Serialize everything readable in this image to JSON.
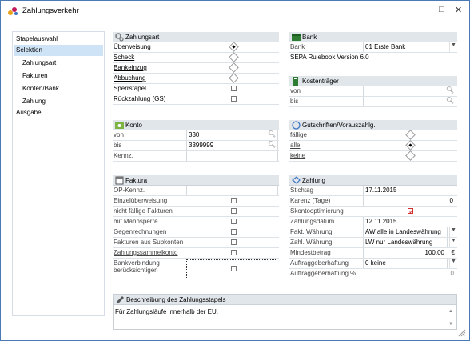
{
  "window": {
    "title": "Zahlungsverkehr",
    "minimize": "□",
    "close": "✕"
  },
  "sidebar": {
    "items": [
      {
        "label": "Stapelauswahl"
      },
      {
        "label": "Selektion"
      },
      {
        "label": "Zahlungsart"
      },
      {
        "label": "Fakturen"
      },
      {
        "label": "Konten/Bank"
      },
      {
        "label": "Zahlung"
      },
      {
        "label": "Ausgabe"
      }
    ]
  },
  "zahlungsart": {
    "title": "Zahlungsart",
    "rows": [
      {
        "label": "Überweisung",
        "type": "radio",
        "checked": true
      },
      {
        "label": "Scheck",
        "type": "radio",
        "checked": false
      },
      {
        "label": "Bankeinzug",
        "type": "radio",
        "checked": false
      },
      {
        "label": "Abbuchung",
        "type": "radio",
        "checked": false
      },
      {
        "label": "Sperrstapel",
        "type": "check",
        "checked": false
      },
      {
        "label": "Rückzahlung (GS)",
        "type": "check",
        "checked": false
      }
    ]
  },
  "bank": {
    "title": "Bank",
    "label": "Bank",
    "value": "01  Erste Bank",
    "info": "SEPA Rulebook Version 6.0"
  },
  "kostentraeger": {
    "title": "Kostenträger",
    "rows": [
      {
        "label": "von",
        "value": ""
      },
      {
        "label": "bis",
        "value": ""
      }
    ]
  },
  "konto": {
    "title": "Konto",
    "rows": [
      {
        "label": "von",
        "value": "330"
      },
      {
        "label": "bis",
        "value": "3399999"
      },
      {
        "label": "Kennz.",
        "value": ""
      }
    ]
  },
  "gutschriften": {
    "title": "Gutschriften/Vorauszahlg.",
    "rows": [
      {
        "label": "fällige",
        "checked": false
      },
      {
        "label": "alle",
        "checked": true
      },
      {
        "label": "keine",
        "checked": false
      }
    ]
  },
  "faktura": {
    "title": "Faktura",
    "rows": [
      {
        "label": "OP-Kennz.",
        "type": "text"
      },
      {
        "label": "Einzelüberweisung",
        "type": "check"
      },
      {
        "label": "nicht fällige Fakturen",
        "type": "check"
      },
      {
        "label": "mit Mahnsperre",
        "type": "check"
      },
      {
        "label": "Gegenrechnungen",
        "type": "check"
      },
      {
        "label": "Fakturen aus Subkonten",
        "type": "check"
      },
      {
        "label": "Zahlungssammelkonto",
        "type": "check"
      }
    ],
    "bankverbindung": "Bankverbindung berücksichtigen"
  },
  "zahlung": {
    "title": "Zahlung",
    "rows": [
      {
        "label": "Stichtag",
        "value": "17.11.2015"
      },
      {
        "label": "Karenz (Tage)",
        "value": "0"
      },
      {
        "label": "Skontooptimierung",
        "value": "✓"
      },
      {
        "label": "Zahlungsdatum",
        "value": "12.11.2015"
      },
      {
        "label": "Fakt. Währung",
        "value": "AW   alle in Landeswährung"
      },
      {
        "label": "Zahl. Währung",
        "value": "LW   nur Landeswährung"
      },
      {
        "label": "Mindestbetrag",
        "value": "100,00",
        "unit": "€"
      },
      {
        "label": "Auftraggeberhaftung",
        "value": "0 keine"
      },
      {
        "label": "Auftraggeberhaftung %",
        "value": "0"
      }
    ]
  },
  "beschreibung": {
    "title": "Beschreibung des Zahlungsstapels",
    "text": "Für Zahlungsläufe innerhalb der EU."
  }
}
